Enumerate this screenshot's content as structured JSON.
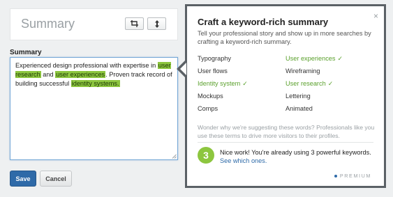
{
  "summary_card": {
    "title": "Summary"
  },
  "field": {
    "label": "Summary",
    "text_parts": [
      {
        "text": "Experienced design professional with expertise in ",
        "highlight": false
      },
      {
        "text": "user research",
        "highlight": true
      },
      {
        "text": " and ",
        "highlight": false
      },
      {
        "text": "user experiences",
        "highlight": true
      },
      {
        "text": ". Proven track record of building successful ",
        "highlight": false
      },
      {
        "text": "identity systems.",
        "highlight": true
      }
    ]
  },
  "actions": {
    "save_label": "Save",
    "cancel_label": "Cancel"
  },
  "popover": {
    "close_glyph": "×",
    "title": "Craft a keyword-rich summary",
    "description": "Tell your professional story and show up in more searches by crafting a keyword-rich summary.",
    "keywords": [
      {
        "label": "Typography",
        "used": false
      },
      {
        "label": "User experiences",
        "used": true
      },
      {
        "label": "User flows",
        "used": false
      },
      {
        "label": "Wireframing",
        "used": false
      },
      {
        "label": "Identity system",
        "used": true
      },
      {
        "label": "User research",
        "used": true
      },
      {
        "label": "Mockups",
        "used": false
      },
      {
        "label": "Lettering",
        "used": false
      },
      {
        "label": "Comps",
        "used": false
      },
      {
        "label": "Animated",
        "used": false
      }
    ],
    "check_glyph": "✓",
    "why_text": "Wonder why we're suggesting these words? Professionals like you use these terms to drive more visitors to their profiles.",
    "count": "3",
    "nice_text": "Nice work! You're already using 3 powerful keywords.",
    "see_link": "See which ones.",
    "premium_label": "PREMIUM"
  },
  "colors": {
    "accent_blue": "#2e6aa8",
    "keyword_green": "#5aa02c",
    "highlight_green": "#8dc63f"
  },
  "icons": [
    "crop-icon",
    "vertical-move-icon",
    "close-icon",
    "check-icon",
    "resize-grip-icon"
  ]
}
